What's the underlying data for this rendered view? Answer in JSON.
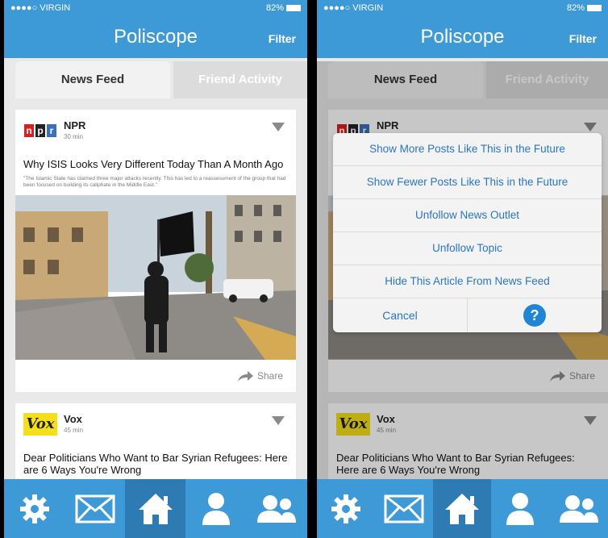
{
  "status": {
    "carrier": "●●●●○ VIRGIN",
    "battery": "82%"
  },
  "header": {
    "title": "Poliscope",
    "filter_label": "Filter"
  },
  "tabs": {
    "news_feed": "News Feed",
    "friend_activity": "Friend Activity"
  },
  "posts": [
    {
      "source": "NPR",
      "time": "30 min",
      "headline": "Why ISIS Looks Very Different Today Than A Month Ago",
      "snippet": "\"The Islamic State has claimed three major attacks recently. This has led to a reassessment of the group that had been focused on building its caliphate in the Middle East.\"",
      "share_label": "Share"
    },
    {
      "source": "Vox",
      "time": "45 min",
      "headline": "Dear Politicians Who Want to Bar Syrian Refugees: Here are 6 Ways You're Wrong",
      "logo_text": "Vox"
    }
  ],
  "npr_letters": [
    "n",
    "p",
    "r"
  ],
  "action_sheet": {
    "options": [
      "Show More Posts Like This in the Future",
      "Show Fewer Posts Like This in the Future",
      "Unfollow News Outlet",
      "Unfollow Topic",
      "Hide This Article From News Feed"
    ],
    "cancel": "Cancel",
    "help": "?"
  },
  "tab_bar": [
    "gear-icon",
    "mail-icon",
    "home-icon",
    "user-icon",
    "friends-icon"
  ],
  "colors": {
    "brand_blue": "#3e9ad6",
    "link_blue": "#2a76c0",
    "npr_red": "#d62021",
    "npr_black": "#222222",
    "npr_blue": "#3b6fb6",
    "vox_yellow": "#f5df18"
  }
}
